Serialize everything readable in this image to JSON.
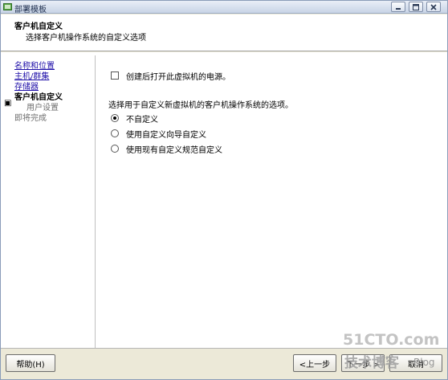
{
  "window": {
    "title": "部署模板"
  },
  "header": {
    "title": "客户机自定义",
    "subtitle": "选择客户机操作系统的自定义选项"
  },
  "nav": {
    "items": [
      {
        "label": "名称和位置",
        "state": "link"
      },
      {
        "label": "主机/群集",
        "state": "link"
      },
      {
        "label": "存储器",
        "state": "link"
      },
      {
        "label": "客户机自定义",
        "state": "current"
      },
      {
        "label": "用户设置",
        "state": "disabled"
      },
      {
        "label": "即将完成",
        "state": "disabled"
      }
    ]
  },
  "content": {
    "power_on_checkbox": {
      "label": "创建后打开此虚拟机的电源。",
      "checked": false
    },
    "options_label": "选择用于自定义新虚拟机的客户机操作系统的选项。",
    "radios": [
      {
        "label": "不自定义",
        "selected": true
      },
      {
        "label": "使用自定义向导自定义",
        "selected": false
      },
      {
        "label": "使用现有自定义规范自定义",
        "selected": false
      }
    ]
  },
  "footer": {
    "help_label": "帮助(H)",
    "back_label": "<上一步",
    "next_label": "下一步 >",
    "cancel_label": "取消"
  },
  "watermark": {
    "site": "51CTO.com",
    "tagline": "技术博客",
    "blog": "Blog"
  },
  "colors": {
    "link": "#1e0ea8",
    "titlebar_top": "#e9eef7",
    "titlebar_bottom": "#c8d4e6",
    "dialog_bg": "#ece9d8"
  }
}
